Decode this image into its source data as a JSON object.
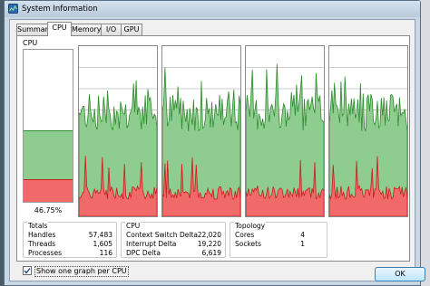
{
  "window": {
    "title": "System Information"
  },
  "tabs": [
    {
      "label": "Summary",
      "active": false
    },
    {
      "label": "CPU",
      "active": true
    },
    {
      "label": "Memory",
      "active": false
    },
    {
      "label": "I/O",
      "active": false
    },
    {
      "label": "GPU",
      "active": false
    }
  ],
  "cpu_usage": {
    "caption": "CPU",
    "percent_label": "46.75%",
    "total_percent": 46.75,
    "kernel_percent": 15
  },
  "colors": {
    "user_fill": "#8fcc8f",
    "user_line": "#2e8b2e",
    "kernel_fill": "#f06a6a",
    "kernel_line": "#c81e1e",
    "grid": "#9a9a9a",
    "tab_border": "#8a8a8a",
    "ok_border": "#3c7fb1"
  },
  "cpu_graph_count": 4,
  "totals": {
    "title": "Totals",
    "rows": [
      {
        "label": "Handles",
        "value": "57,483"
      },
      {
        "label": "Threads",
        "value": "1,605"
      },
      {
        "label": "Processes",
        "value": "116"
      }
    ]
  },
  "cpu_stats": {
    "title": "CPU",
    "rows": [
      {
        "label": "Context Switch Delta",
        "value": "22,020"
      },
      {
        "label": "Interrupt Delta",
        "value": "19,220"
      },
      {
        "label": "DPC Delta",
        "value": "6,619"
      }
    ]
  },
  "topology": {
    "title": "Topology",
    "rows": [
      {
        "label": "Cores",
        "value": "4"
      },
      {
        "label": "Sockets",
        "value": "1"
      }
    ]
  },
  "show_one_graph_per_cpu": {
    "label": "Show one graph per CPU",
    "checked": true
  },
  "ok_button": {
    "label": "OK"
  }
}
